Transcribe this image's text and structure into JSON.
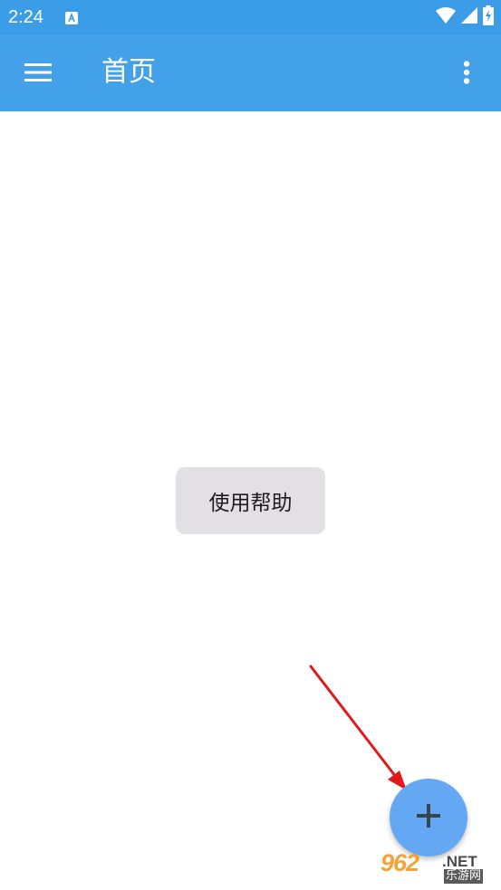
{
  "status_bar": {
    "time": "2:24",
    "notification_icon": "a-letter-icon",
    "icons": [
      "wifi-icon",
      "cellular-signal-icon",
      "battery-charging-icon"
    ]
  },
  "app_bar": {
    "title": "首页",
    "menu_icon": "hamburger-menu-icon",
    "overflow_icon": "more-vertical-icon"
  },
  "content": {
    "help_button_label": "使用帮助"
  },
  "fab": {
    "icon": "plus-icon"
  },
  "annotation": {
    "arrow_icon": "red-arrow-icon"
  },
  "watermark": {
    "logo_text": "962",
    "logo_suffix": ".NET",
    "subtitle": "乐游网"
  },
  "colors": {
    "status_bar": "#3b9de8",
    "app_bar": "#42a1e9",
    "fab": "#64a8f4",
    "help_chip": "#e3e0e5",
    "arrow": "#e0191b"
  }
}
